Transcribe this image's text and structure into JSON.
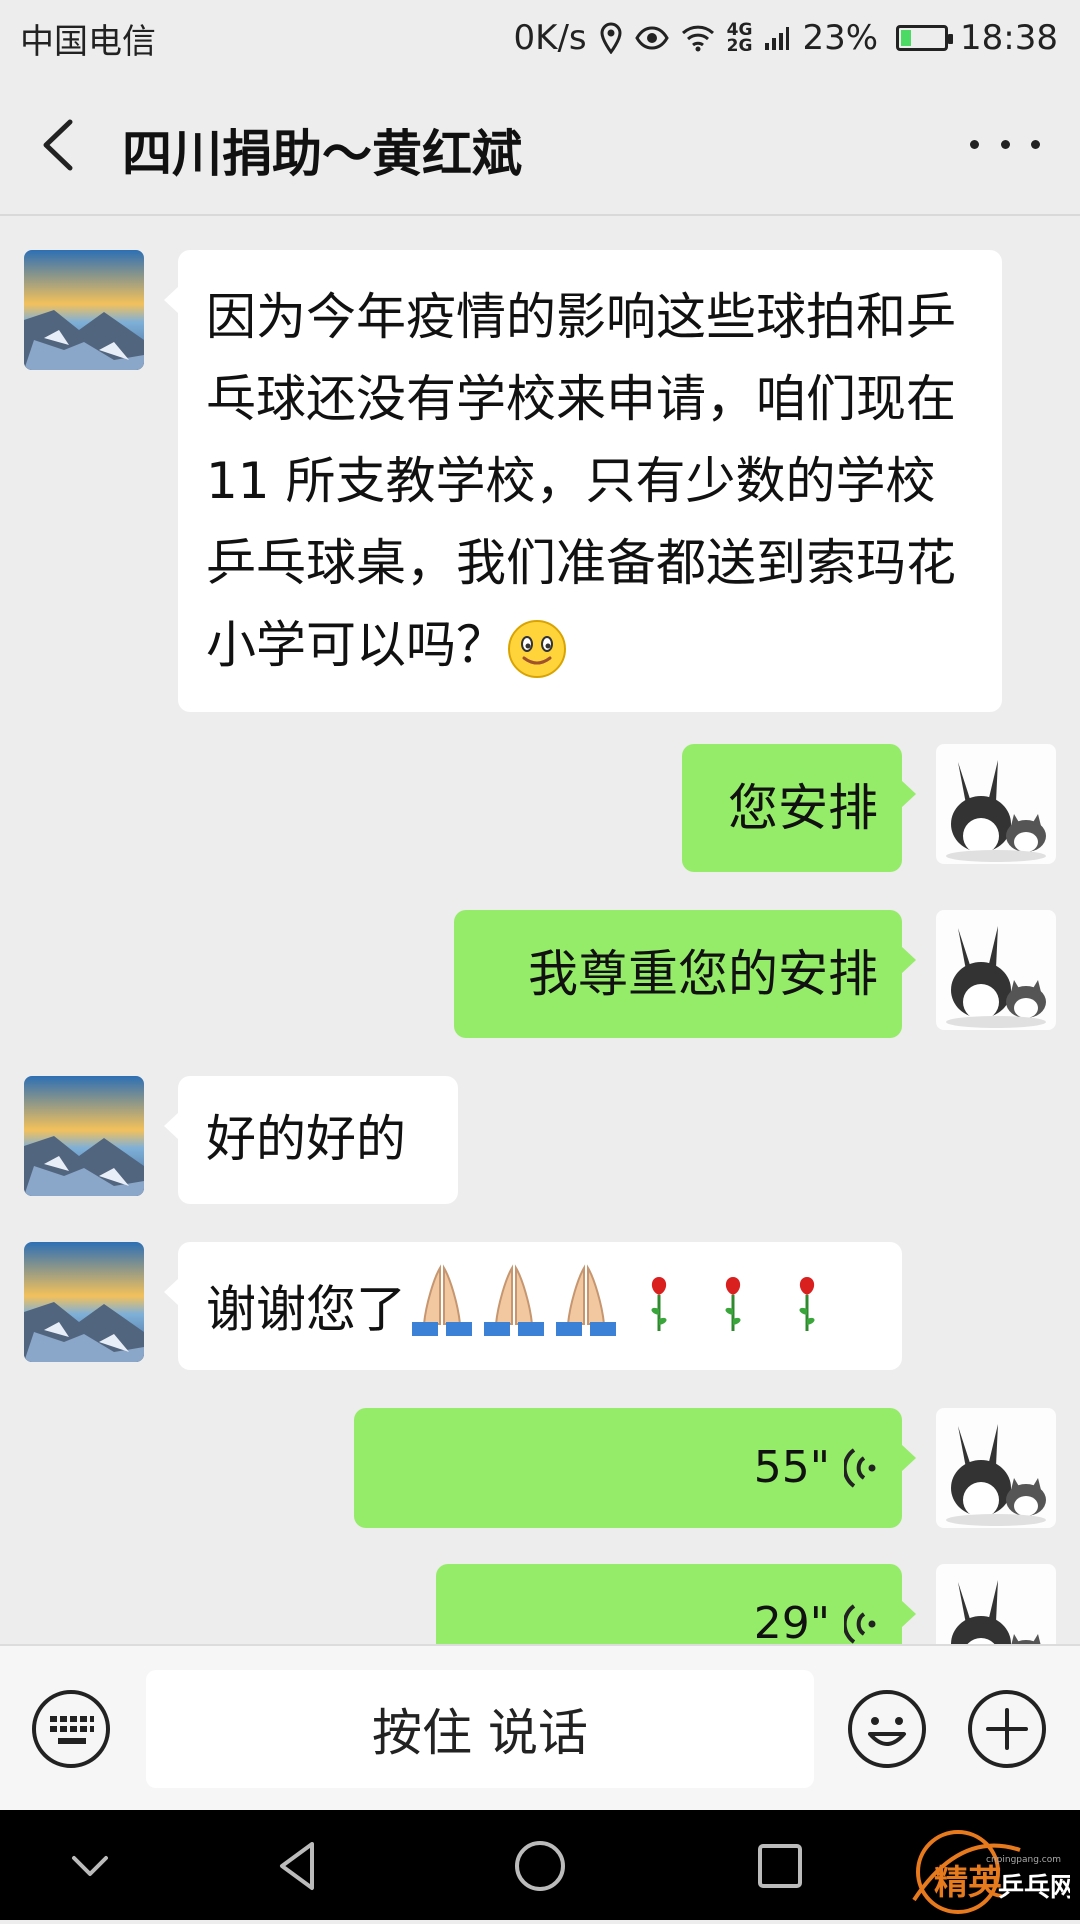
{
  "status_bar": {
    "carrier": "中国电信",
    "speed": "0K/s",
    "network_top": "4G",
    "network_bottom": "2G",
    "battery_percent": "23%",
    "battery_level": 0.23,
    "time": "18:38"
  },
  "header": {
    "title": "四川捐助～黄红斌"
  },
  "messages": [
    {
      "side": "in",
      "type": "text",
      "text": "因为今年疫情的影响这些球拍和乒乓球还没有学校来申请，咱们现在 11 所支教学校，只有少数的学校乒乓球桌，我们准备都送到索玛花小学可以吗？",
      "emoji": "smile"
    },
    {
      "side": "out",
      "type": "text",
      "text": "您安排"
    },
    {
      "side": "out",
      "type": "text",
      "text": "我尊重您的安排"
    },
    {
      "side": "in",
      "type": "text",
      "text": "好的好的"
    },
    {
      "side": "in",
      "type": "text",
      "text": "谢谢您了",
      "emojis": [
        "pray",
        "pray",
        "pray",
        "rose",
        "rose",
        "rose"
      ]
    },
    {
      "side": "out",
      "type": "voice",
      "duration": "55\""
    },
    {
      "side": "out",
      "type": "voice",
      "duration": "29\""
    }
  ],
  "input_bar": {
    "hold_to_talk": "按住 说话"
  },
  "watermark": {
    "text": "精英乒乓网",
    "url": "cnpingpang.com"
  },
  "colors": {
    "outgoing_bubble": "#95ec69",
    "incoming_bubble": "#ffffff",
    "background": "#ededed"
  }
}
